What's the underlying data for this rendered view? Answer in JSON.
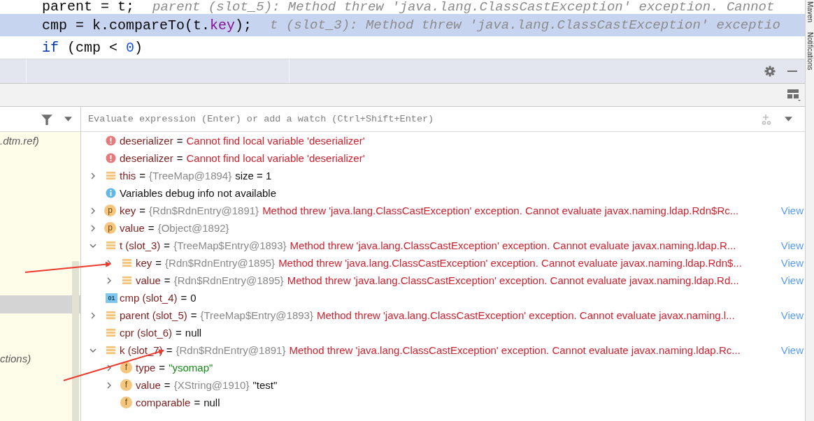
{
  "code_lines": [
    {
      "highlighted": false,
      "tokens": [
        {
          "kind": "plain",
          "text": "parent = t;"
        },
        {
          "kind": "hint",
          "text": "parent (slot_5): Method threw 'java.lang.ClassCastException' exception. Cannot"
        }
      ]
    },
    {
      "highlighted": true,
      "tokens": [
        {
          "kind": "plain",
          "text": "cmp = k.compareTo(t."
        },
        {
          "kind": "field",
          "text": "key"
        },
        {
          "kind": "plain",
          "text": ");"
        },
        {
          "kind": "hint",
          "text": "t (slot_3): Method threw 'java.lang.ClassCastException' exceptio"
        }
      ]
    },
    {
      "highlighted": false,
      "tokens": [
        {
          "kind": "keyword",
          "text": "if"
        },
        {
          "kind": "plain",
          "text": " (cmp < "
        },
        {
          "kind": "number",
          "text": "0"
        },
        {
          "kind": "plain",
          "text": ")"
        }
      ]
    }
  ],
  "side_strip": [
    "Maven",
    "Notifications"
  ],
  "frames_panel": {
    "frames": [
      {
        "text": ".dtm.ref)",
        "selected": false
      },
      {
        "selected": false
      },
      {
        "selected": false
      },
      {
        "selected": false
      },
      {
        "selected": false
      },
      {
        "selected": false
      },
      {
        "selected": false
      },
      {
        "selected": false
      },
      {
        "selected": false
      },
      {
        "selected": true
      },
      {
        "selected": false
      },
      {
        "selected": false
      },
      {
        "text": "ctions)",
        "selected": false
      }
    ]
  },
  "watch_field": {
    "placeholder": "Evaluate expression (Enter) or add a watch (Ctrl+Shift+Enter)"
  },
  "variables": [
    {
      "kind": "error",
      "name": "deserializer",
      "eq": "=",
      "error": "Cannot find local variable 'deserializer'"
    },
    {
      "kind": "error",
      "name": "deserializer",
      "eq": "=",
      "error": "Cannot find local variable 'deserializer'"
    },
    {
      "kind": "object",
      "expanded": false,
      "name": "this",
      "eq": "=",
      "ref": "{TreeMap@1894}",
      "value": {
        "kind": "plain",
        "text": "size = 1"
      }
    },
    {
      "kind": "info",
      "message": "Variables debug info not available"
    },
    {
      "kind": "badge",
      "badge": "p",
      "expanded": false,
      "name": "key",
      "eq": "=",
      "ref": "{Rdn$RdnEntry@1891}",
      "error": "Method threw 'java.lang.ClassCastException' exception. Cannot evaluate javax.naming.ldap.Rdn$Rc...",
      "link": "View"
    },
    {
      "kind": "badge",
      "badge": "p",
      "expanded": false,
      "name": "value",
      "eq": "=",
      "ref": "{Object@1892}"
    },
    {
      "kind": "object",
      "expanded": true,
      "name": "t (slot_3)",
      "eq": "=",
      "ref": "{TreeMap$Entry@1893}",
      "error": "Method threw 'java.lang.ClassCastException' exception. Cannot evaluate javax.naming.ldap.R...",
      "link": "View",
      "children": [
        {
          "kind": "object",
          "expanded": false,
          "name": "key",
          "eq": "=",
          "ref": "{Rdn$RdnEntry@1895}",
          "error": "Method threw 'java.lang.ClassCastException' exception. Cannot evaluate javax.naming.ldap.Rdn$...",
          "link": "View"
        },
        {
          "kind": "object",
          "expanded": false,
          "name": "value",
          "eq": "=",
          "ref": "{Rdn$RdnEntry@1895}",
          "error": "Method threw 'java.lang.ClassCastException' exception. Cannot evaluate javax.naming.ldap.Rd...",
          "link": "View"
        }
      ]
    },
    {
      "kind": "number",
      "badge": "01",
      "name": "cmp (slot_4)",
      "eq": "=",
      "value": {
        "kind": "plain",
        "text": "0"
      }
    },
    {
      "kind": "object",
      "expanded": false,
      "name": "parent (slot_5)",
      "eq": "=",
      "ref": "{TreeMap$Entry@1893}",
      "error": "Method threw 'java.lang.ClassCastException' exception. Cannot evaluate javax.naming.l...",
      "link": "View"
    },
    {
      "kind": "object",
      "name": "cpr (slot_6)",
      "eq": "=",
      "value": {
        "kind": "plain",
        "text": "null"
      }
    },
    {
      "kind": "object",
      "expanded": true,
      "name": "k (slot_7)",
      "eq": "=",
      "ref": "{Rdn$RdnEntry@1891}",
      "error": "Method threw 'java.lang.ClassCastException' exception. Cannot evaluate javax.naming.ldap.Rc...",
      "link": "View",
      "children": [
        {
          "kind": "badge",
          "badge": "f",
          "expanded": false,
          "name": "type",
          "eq": "=",
          "value": {
            "kind": "string",
            "text": "\"ysomap\""
          }
        },
        {
          "kind": "badge",
          "badge": "f",
          "expanded": false,
          "name": "value",
          "eq": "=",
          "ref": "{XString@1910}",
          "value": {
            "kind": "plain",
            "text": "\"test\""
          }
        },
        {
          "kind": "badge",
          "badge": "f",
          "name": "comparable",
          "eq": "=",
          "value": {
            "kind": "plain",
            "text": "null"
          }
        }
      ]
    }
  ]
}
